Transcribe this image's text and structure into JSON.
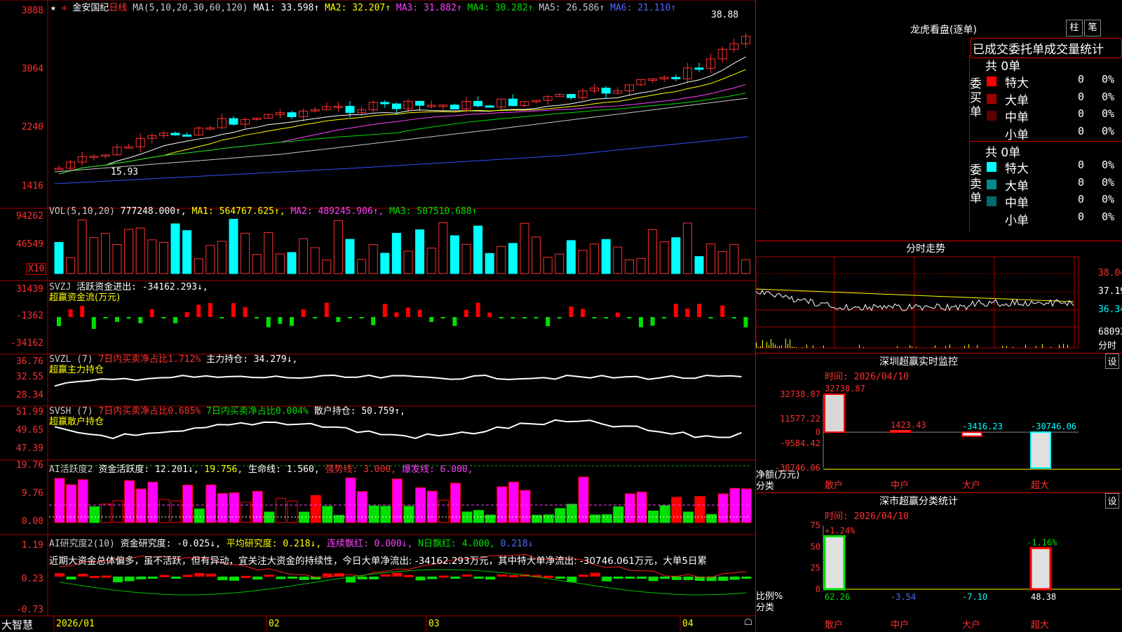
{
  "app": {
    "name": "大智慧",
    "stock": "金安国纪",
    "period": "日线"
  },
  "ma_header": {
    "params": "MA(5,10,20,30,60,120)",
    "ma1": "MA1: 33.598↑",
    "ma2": "MA2: 32.207↑",
    "ma3": "MA3: 31.882↑",
    "ma4": "MA4: 30.282↑",
    "ma5": "MA5: 26.586↑",
    "ma6": "MA6: 21.110↑"
  },
  "price_axis": [
    "3888",
    "3064",
    "2240",
    "1416"
  ],
  "price_marks": {
    "high": "38.88",
    "low": "15.93"
  },
  "vol_header": {
    "label": "VOL(5,10,20)",
    "value": "777248.000↑,",
    "ma1": "MA1: 564767.625↑,",
    "ma2": "MA2: 489245.906↑,",
    "ma3": "MA3: 507510.688↑"
  },
  "vol_axis": [
    "94262",
    "46549"
  ],
  "vol_unit": "X10",
  "svzj_header": {
    "label": "SVZJ",
    "text": "活跃资金进出: -34162.293↓,",
    "sub": "超赢资金流(万元)"
  },
  "svzj_axis": [
    "31439",
    "-1362",
    "-34162"
  ],
  "svzl_header": {
    "label": "SVZL (7)",
    "ratio": "7日内买卖净占比1.712%",
    "hold": "主力持仓: 34.279↓,",
    "sub": "超赢主力持仓"
  },
  "svzl_axis": [
    "36.76",
    "32.55",
    "28.34"
  ],
  "svsh_header": {
    "label": "SVSH (7)",
    "ratio1": "7日内买卖净占比0.685%",
    "ratio2": "7日内买卖净占比0.004%",
    "hold": "散户持仓: 50.759↑,",
    "sub": "超赢散户持仓"
  },
  "svsh_axis": [
    "51.99",
    "49.65",
    "47.39"
  ],
  "ai1_header": {
    "label": "AI活跃度2",
    "active": "资金活跃度: 12.201↓,",
    "v2": "19.756,",
    "life": "生命线: 1.560,",
    "strong": "强势线: 3.000,",
    "burst": "爆发线: 6.000,"
  },
  "ai1_axis": [
    "19.76",
    "9.76",
    "0.00"
  ],
  "ai2_header": {
    "label": "AI研究度2(10)",
    "research": "资金研究度: -0.025↓,",
    "avg": "平均研究度: 0.218↓,",
    "red": "连续飘红: 0.000↓,",
    "nred": "N日飘红: 4.000,",
    "last": "0.218↓"
  },
  "ai2_text": "近期大资金总体偏多，虽不活跃，但有异动，宜关注大资金的持续性，今日大单净流出: -34162.293万元，其中特大单净流出: -30746.061万元，大单5日累",
  "ai2_axis": [
    "1.19",
    "0.23",
    "-0.73"
  ],
  "time_axis": [
    "2026/01",
    "02",
    "03",
    "04"
  ],
  "dragon": {
    "title": "龙虎看盘(逐单)",
    "btn1": "柱",
    "btn2": "笔",
    "tabs": "已成交委托单成交量统计",
    "buy_total": "共 0单",
    "sell_total": "共 0单",
    "buy_label": "委买单",
    "sell_label": "委卖单",
    "buy_rows": [
      {
        "name": "特大",
        "count": "0",
        "pct": "0%",
        "color": "#ff0000"
      },
      {
        "name": "大单",
        "count": "0",
        "pct": "0%",
        "color": "#a00000"
      },
      {
        "name": "中单",
        "count": "0",
        "pct": "0%",
        "color": "#600000"
      },
      {
        "name": "小单",
        "count": "0",
        "pct": "0%",
        "color": "#000000"
      }
    ],
    "sell_rows": [
      {
        "name": "特大",
        "count": "0",
        "pct": "0%",
        "color": "#00ffff"
      },
      {
        "name": "大单",
        "count": "0",
        "pct": "0%",
        "color": "#008c8c"
      },
      {
        "name": "中单",
        "count": "0",
        "pct": "0%",
        "color": "#006c6c"
      },
      {
        "name": "小单",
        "count": "0",
        "pct": "0%",
        "color": "#000000"
      }
    ]
  },
  "intraday": {
    "title": "分时走势",
    "axis": [
      "38.04",
      "37.19",
      "36.34",
      "68093"
    ],
    "sub": "分时"
  },
  "monitor": {
    "title": "深圳超赢实时监控",
    "btn": "设",
    "date": "时间: 2026/04/10",
    "axis": [
      "32738.87",
      "11577.22",
      "0",
      "-9584.42",
      "-30746.06"
    ],
    "ylabel": "净额(万元)",
    "xlabel": "分类",
    "categories": [
      "散户",
      "中户",
      "大户",
      "超大"
    ],
    "values": [
      "32738.87",
      "1423.43",
      "-3416.23",
      "-30746.06"
    ]
  },
  "classify": {
    "title": "深市超赢分类统计",
    "btn": "设",
    "date": "时间: 2026/04/10",
    "axis": [
      "75",
      "50",
      "25",
      "0"
    ],
    "ylabel": "比例%",
    "xlabel": "分类",
    "categories": [
      "散户",
      "中户",
      "大户",
      "超大"
    ],
    "pct_top": [
      "+1.24%",
      "",
      "",
      "-1.16%"
    ],
    "values": [
      "62.26",
      "-3.54",
      "-7.10",
      "48.38"
    ]
  },
  "chart_data": {
    "type": "bar",
    "title": "深圳超赢实时监控",
    "ylabel": "净额(万元)",
    "xlabel": "分类",
    "categories": [
      "散户",
      "中户",
      "大户",
      "超大"
    ],
    "values": [
      32738.87,
      1423.43,
      -3416.23,
      -30746.06
    ],
    "ylim": [
      -30746.06,
      32738.87
    ]
  }
}
